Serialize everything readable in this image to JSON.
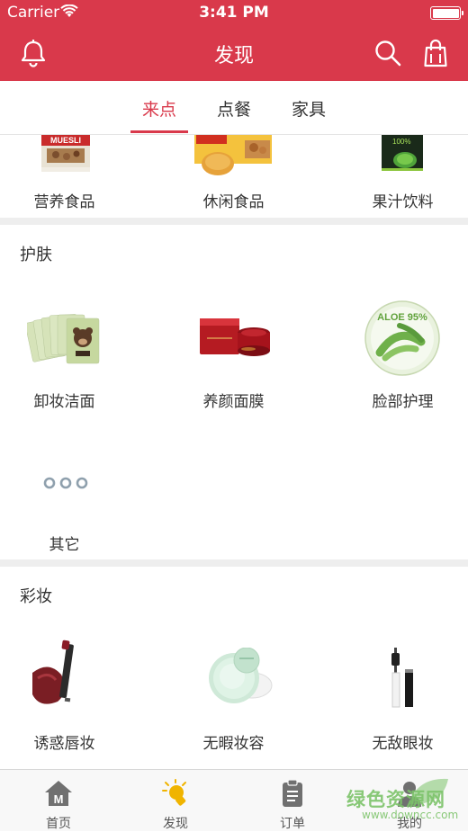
{
  "status": {
    "carrier": "Carrier",
    "time": "3:41 PM"
  },
  "nav": {
    "title": "发现"
  },
  "tabs": [
    {
      "label": "来点",
      "active": true
    },
    {
      "label": "点餐",
      "active": false
    },
    {
      "label": "家具",
      "active": false
    }
  ],
  "food_row": [
    {
      "label": "营养食品",
      "icon": "muesli-box-image",
      "package_text": "MUESLI"
    },
    {
      "label": "休闲食品",
      "icon": "snack-box-image"
    },
    {
      "label": "果汁饮料",
      "icon": "green-powder-box-image",
      "package_text": "100%"
    }
  ],
  "skincare": {
    "title": "护肤",
    "items": [
      {
        "label": "卸妆洁面",
        "icon": "face-mask-packs-image"
      },
      {
        "label": "养颜面膜",
        "icon": "red-cream-jar-image"
      },
      {
        "label": "脸部护理",
        "icon": "aloe-gel-jar-image",
        "package_text": "ALOE 95%"
      },
      {
        "label": "其它",
        "icon": "more-dots-icon"
      }
    ]
  },
  "makeup": {
    "title": "彩妆",
    "items": [
      {
        "label": "诱惑唇妆",
        "icon": "lipstick-image"
      },
      {
        "label": "无暇妆容",
        "icon": "compact-powder-image"
      },
      {
        "label": "无敌眼妆",
        "icon": "mascara-image"
      }
    ]
  },
  "tabbar": [
    {
      "label": "首页",
      "icon": "home-icon"
    },
    {
      "label": "发现",
      "icon": "lightbulb-icon"
    },
    {
      "label": "订单",
      "icon": "clipboard-icon"
    },
    {
      "label": "我的",
      "icon": "profile-icon"
    }
  ],
  "watermark": {
    "text": "绿色资源网",
    "url": "www.downcc.com"
  },
  "colors": {
    "brand": "#d9394b",
    "tabbar_active": "#f0b400",
    "separator": "#eeeeee"
  }
}
